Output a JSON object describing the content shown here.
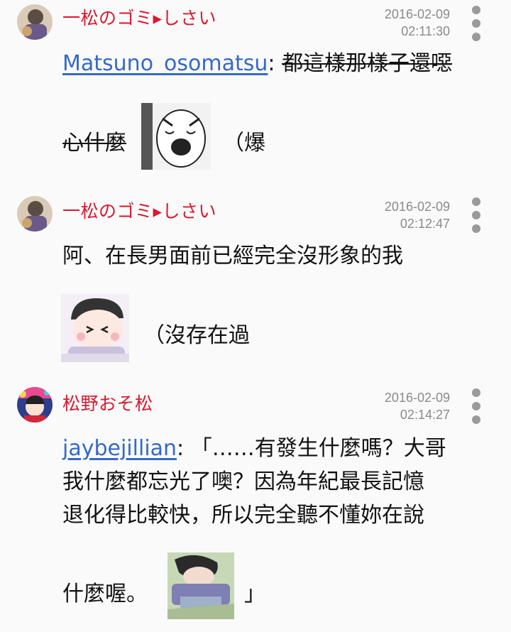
{
  "comments": [
    {
      "author": "一松のゴミ▸しさい",
      "date": "2016-02-09",
      "time": "02:11:30",
      "mention": "Matsuno_osomatsu",
      "colon": ":",
      "strike_line1": "都這樣那樣子還噁",
      "strike_line2": "心什麼",
      "after_sticker": "（爆"
    },
    {
      "author": "一松のゴミ▸しさい",
      "date": "2016-02-09",
      "time": "02:12:47",
      "line1": "阿、在長男面前已經完全沒形象的我",
      "after_sticker": "（沒存在過"
    },
    {
      "author": "松野おそ松",
      "date": "2016-02-09",
      "time": "02:14:27",
      "mention": "jaybejillian",
      "line1_rest": ": 「……有發生什麼嗎？大哥",
      "line2": "我什麼都忘光了噢？因為年紀最長記憶",
      "line3": "退化得比較快，所以完全聽不懂妳在說",
      "line4": "什麼喔。",
      "closing": "」"
    }
  ],
  "colors": {
    "author": "#d8192f",
    "mention": "#3569c9",
    "date": "#8a8a8a",
    "background": "#fafafa"
  }
}
